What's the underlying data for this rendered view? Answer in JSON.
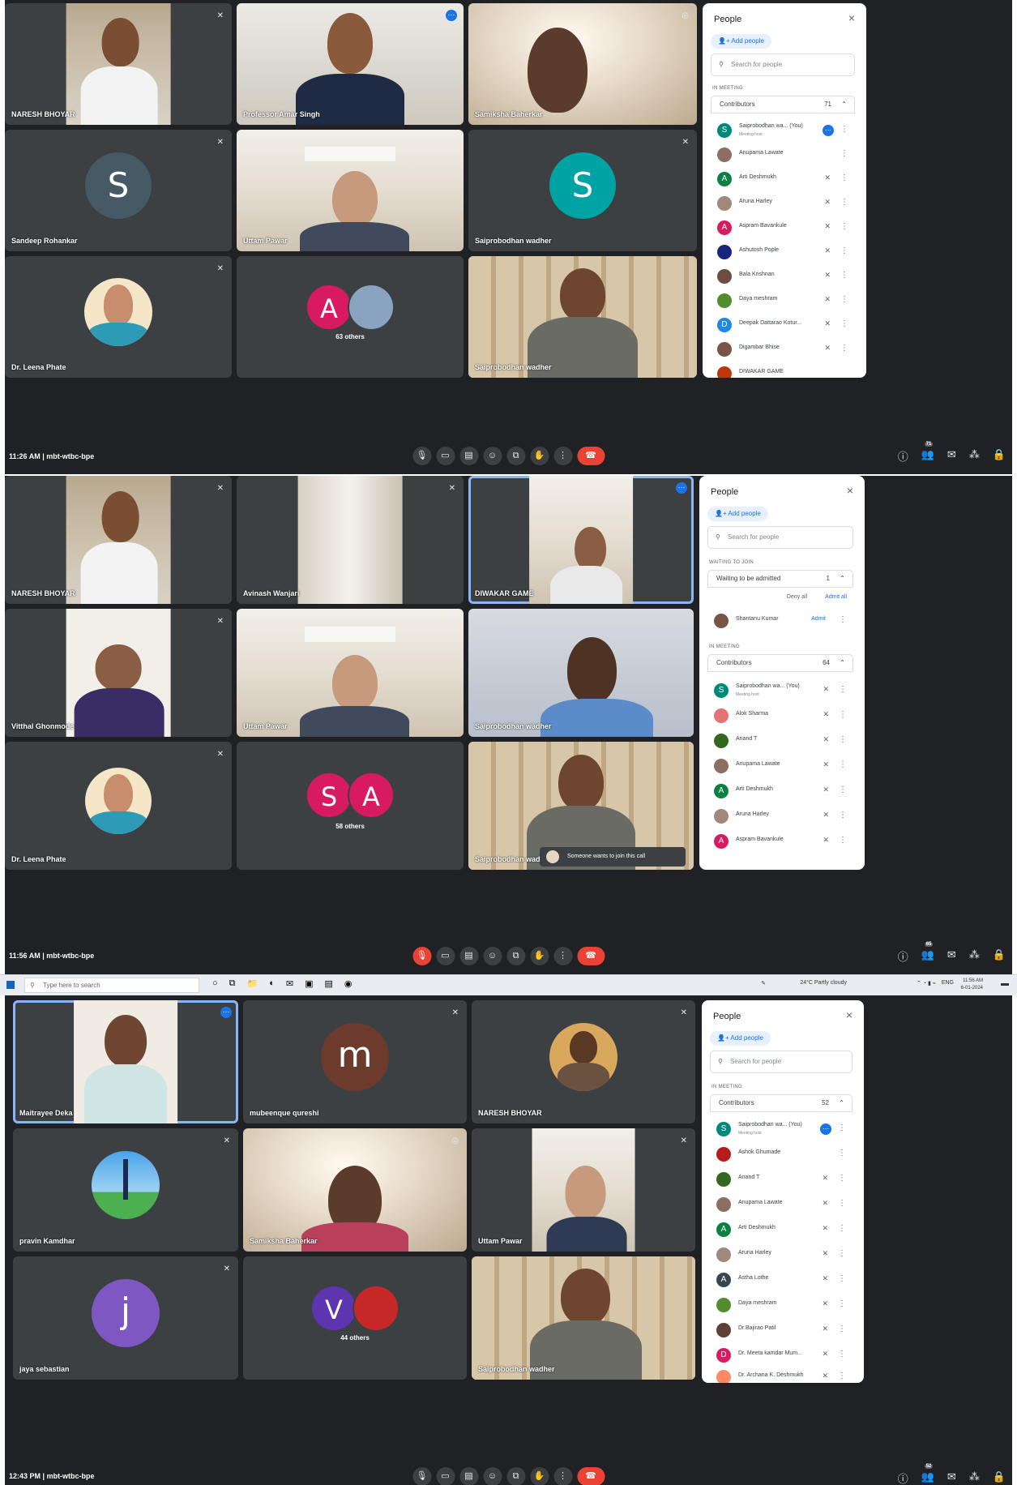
{
  "shots": [
    {
      "clock": "11:26 AM",
      "meeting_code": "mbt-wtbc-bpe",
      "tiles": [
        {
          "name": "NARESH BHOYAR"
        },
        {
          "name": "Professor Amar Singh"
        },
        {
          "name": "Samiksha Baherkar"
        },
        {
          "name": "Sandeep Rohankar",
          "letter": "S"
        },
        {
          "name": "Uttam Pawar"
        },
        {
          "name": "Saiprobodhan wadher",
          "letter": "S"
        },
        {
          "name": "Dr. Leena Phate"
        },
        {
          "others_letters": [
            "A"
          ],
          "others_count": "63 others"
        },
        {
          "name": "Saiprobodhan wadher"
        }
      ],
      "badge": "71",
      "panel": {
        "title": "People",
        "add_label": "Add people",
        "search_placeholder": "Search for people",
        "in_meeting": "IN MEETING",
        "group_label": "Contributors",
        "group_count": "71",
        "rows": [
          {
            "name": "Saiprobodhan wa...   (You)",
            "sub": "Meeting host",
            "letter": "S",
            "color": "#00897b"
          },
          {
            "name": "Anupama Lawate",
            "letter": "",
            "color": "#8d6e63"
          },
          {
            "name": "Arti Deshmukh",
            "letter": "A",
            "color": "#0b8043"
          },
          {
            "name": "Aruna Harley",
            "letter": "",
            "color": "#a1887f"
          },
          {
            "name": "Aspram Bavankule",
            "letter": "A",
            "color": "#d81b60"
          },
          {
            "name": "Ashutosh Pople",
            "letter": "",
            "color": "#1a237e"
          },
          {
            "name": "Bala Krishnan",
            "letter": "",
            "color": "#6d4c41"
          },
          {
            "name": "Daya meshram",
            "letter": "",
            "color": "#558b2f"
          },
          {
            "name": "Deepak Dattarao Kotur...",
            "letter": "D",
            "color": "#1e88e5"
          },
          {
            "name": "Digambar Bhise",
            "letter": "",
            "color": "#795548"
          },
          {
            "name": "DIWAKAR GAME",
            "letter": "",
            "color": "#bf360c"
          }
        ]
      }
    },
    {
      "clock": "11:56 AM",
      "meeting_code": "mbt-wtbc-bpe",
      "tiles": [
        {
          "name": "NARESH BHOYAR"
        },
        {
          "name": "Avinash Wanjari"
        },
        {
          "name": "DIWAKAR GAME"
        },
        {
          "name": "Vitthal Ghonmode"
        },
        {
          "name": "Uttam Pawar"
        },
        {
          "name": "Saiprobodhan wadher"
        },
        {
          "name": "Dr. Leena Phate"
        },
        {
          "others_letters": [
            "S",
            "A"
          ],
          "others_count": "58 others"
        },
        {
          "name": "Saiprobodhan wadher"
        }
      ],
      "toast": "Someone wants to join this call",
      "badge": "65",
      "panel": {
        "title": "People",
        "add_label": "Add people",
        "search_placeholder": "Search for people",
        "waiting_header": "WAITING TO JOIN",
        "waiting_group": "Waiting to be admitted",
        "waiting_count": "1",
        "deny_all": "Deny all",
        "admit_all": "Admit all",
        "waiting_row": {
          "name": "Shantanu Kumar",
          "admit": "Admit"
        },
        "in_meeting": "IN MEETING",
        "group_label": "Contributors",
        "group_count": "64",
        "rows": [
          {
            "name": "Saiprobodhan wa...  (You)",
            "sub": "Meeting host",
            "letter": "S",
            "color": "#00897b"
          },
          {
            "name": "Alok Sharma",
            "letter": "",
            "color": "#e57373"
          },
          {
            "name": "Anand T",
            "letter": "",
            "color": "#33691e"
          },
          {
            "name": "Anupama Lawate",
            "letter": "",
            "color": "#8d6e63"
          },
          {
            "name": "Arti Deshmukh",
            "letter": "A",
            "color": "#0b8043"
          },
          {
            "name": "Aruna Harley",
            "letter": "",
            "color": "#a1887f"
          },
          {
            "name": "Aspram Bavankule",
            "letter": "A",
            "color": "#d81b60"
          }
        ]
      }
    },
    {
      "clock": "12:43 PM",
      "meeting_code": "mbt-wtbc-bpe",
      "tiles": [
        {
          "name": "Maitrayee Deka"
        },
        {
          "name": "mubeenque qureshi",
          "letter": "m"
        },
        {
          "name": "NARESH BHOYAR"
        },
        {
          "name": "pravin Kamdhar"
        },
        {
          "name": "Samiksha Baherkar"
        },
        {
          "name": "Uttam Pawar"
        },
        {
          "name": "jaya sebastian",
          "letter": "j"
        },
        {
          "others_letters": [
            "V"
          ],
          "others_count": "44 others"
        },
        {
          "name": "Saiprobodhan wadher"
        }
      ],
      "badge": "52",
      "panel": {
        "title": "People",
        "add_label": "Add people",
        "search_placeholder": "Search for people",
        "in_meeting": "IN MEETING",
        "group_label": "Contributors",
        "group_count": "52",
        "rows": [
          {
            "name": "Saiprobodhan wa...  (You)",
            "sub": "Meeting host",
            "letter": "S",
            "color": "#00897b"
          },
          {
            "name": "Ashok Ghumade",
            "letter": "",
            "color": "#b71c1c"
          },
          {
            "name": "Anand T",
            "letter": "",
            "color": "#33691e"
          },
          {
            "name": "Anupama Lawate",
            "letter": "",
            "color": "#8d6e63"
          },
          {
            "name": "Arti Deshmukh",
            "letter": "A",
            "color": "#0b8043"
          },
          {
            "name": "Aruna Harley",
            "letter": "",
            "color": "#a1887f"
          },
          {
            "name": "Astha Lothe",
            "letter": "A",
            "color": "#37474f"
          },
          {
            "name": "Daya meshram",
            "letter": "",
            "color": "#558b2f"
          },
          {
            "name": "Dr.Bajirao Patil",
            "letter": "",
            "color": "#5d4037"
          },
          {
            "name": "Dr. Meeta kamdar Mum...",
            "letter": "D",
            "color": "#d81b60"
          },
          {
            "name": "Dr. Archana K. Deshmukh",
            "letter": "",
            "color": "#ff8a65"
          }
        ]
      }
    }
  ],
  "taskbar": {
    "search_placeholder": "Type here to search",
    "weather": "24°C  Partly cloudy",
    "lang": "ENG",
    "time": "11:56 AM",
    "date": "6-01-2024"
  },
  "colors": {
    "meet_bg": "#202124",
    "tile_bg": "#3c4043",
    "accent": "#1a73e8",
    "end_call": "#ea4335"
  }
}
